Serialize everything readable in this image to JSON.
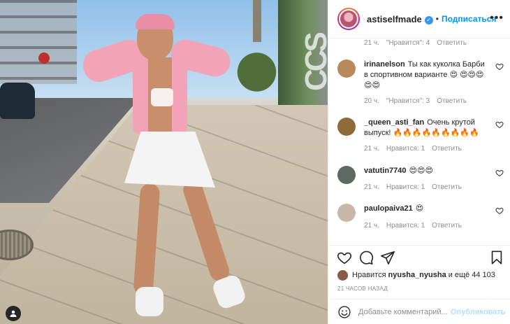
{
  "post": {
    "author": "astiselfmade",
    "follow_label": "Подписаться",
    "dot": "•",
    "more": "•••",
    "avatar_color": "#e78aa0"
  },
  "prev_comment_meta": {
    "time": "21 ч.",
    "likes": "\"Нравится\": 4",
    "reply": "Ответить"
  },
  "comments": [
    {
      "user": "irinanelson",
      "text": "Ты как куколка Барби в спортивном варианте 😍 😍😍😍😍😍",
      "time": "20 ч.",
      "likes": "\"Нравится\": 3",
      "reply": "Ответить",
      "avatar_color": "#b88a5b"
    },
    {
      "user": "_queen_asti_fan",
      "text": "Очень крутой выпуск! 🔥🔥🔥🔥🔥🔥🔥🔥🔥",
      "time": "21 ч.",
      "likes": "Нравится: 1",
      "reply": "Ответить",
      "avatar_color": "#8f6a3a"
    },
    {
      "user": "vatutin7740",
      "text": "😍😍😍",
      "time": "21 ч.",
      "likes": "Нравится: 1",
      "reply": "Ответить",
      "avatar_color": "#5d6a62"
    },
    {
      "user": "paulopaiva21",
      "text": "😍",
      "time": "21 ч.",
      "likes": "Нравится: 1",
      "reply": "Ответить",
      "avatar_color": "#c7b7a8"
    }
  ],
  "likes": {
    "prefix": "Нравится",
    "user": "nyusha_nyusha",
    "suffix": "и ещё 44 103",
    "avatar_color": "#8a5a46"
  },
  "timestamp": "21 ЧАСОВ НАЗАД",
  "add_comment": {
    "placeholder": "Добавьте комментарий...",
    "publish": "Опубликовать"
  },
  "photo": {
    "sign_text": "CCS"
  },
  "icons": [
    "heart-icon",
    "comment-icon",
    "share-icon",
    "bookmark-icon",
    "emoji-icon",
    "user-tag-icon",
    "verified-icon"
  ]
}
